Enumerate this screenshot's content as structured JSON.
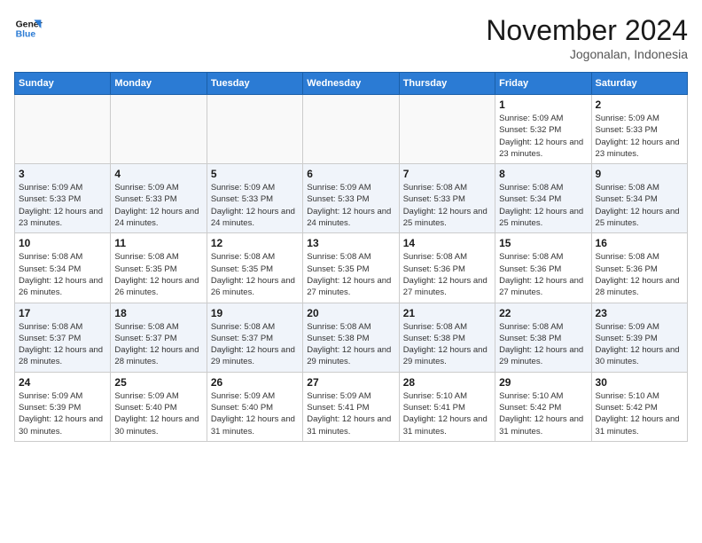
{
  "logo": {
    "line1": "General",
    "line2": "Blue"
  },
  "title": "November 2024",
  "location": "Jogonalan, Indonesia",
  "weekdays": [
    "Sunday",
    "Monday",
    "Tuesday",
    "Wednesday",
    "Thursday",
    "Friday",
    "Saturday"
  ],
  "weeks": [
    [
      {
        "day": "",
        "info": ""
      },
      {
        "day": "",
        "info": ""
      },
      {
        "day": "",
        "info": ""
      },
      {
        "day": "",
        "info": ""
      },
      {
        "day": "",
        "info": ""
      },
      {
        "day": "1",
        "info": "Sunrise: 5:09 AM\nSunset: 5:32 PM\nDaylight: 12 hours and 23 minutes."
      },
      {
        "day": "2",
        "info": "Sunrise: 5:09 AM\nSunset: 5:33 PM\nDaylight: 12 hours and 23 minutes."
      }
    ],
    [
      {
        "day": "3",
        "info": "Sunrise: 5:09 AM\nSunset: 5:33 PM\nDaylight: 12 hours and 23 minutes."
      },
      {
        "day": "4",
        "info": "Sunrise: 5:09 AM\nSunset: 5:33 PM\nDaylight: 12 hours and 24 minutes."
      },
      {
        "day": "5",
        "info": "Sunrise: 5:09 AM\nSunset: 5:33 PM\nDaylight: 12 hours and 24 minutes."
      },
      {
        "day": "6",
        "info": "Sunrise: 5:09 AM\nSunset: 5:33 PM\nDaylight: 12 hours and 24 minutes."
      },
      {
        "day": "7",
        "info": "Sunrise: 5:08 AM\nSunset: 5:33 PM\nDaylight: 12 hours and 25 minutes."
      },
      {
        "day": "8",
        "info": "Sunrise: 5:08 AM\nSunset: 5:34 PM\nDaylight: 12 hours and 25 minutes."
      },
      {
        "day": "9",
        "info": "Sunrise: 5:08 AM\nSunset: 5:34 PM\nDaylight: 12 hours and 25 minutes."
      }
    ],
    [
      {
        "day": "10",
        "info": "Sunrise: 5:08 AM\nSunset: 5:34 PM\nDaylight: 12 hours and 26 minutes."
      },
      {
        "day": "11",
        "info": "Sunrise: 5:08 AM\nSunset: 5:35 PM\nDaylight: 12 hours and 26 minutes."
      },
      {
        "day": "12",
        "info": "Sunrise: 5:08 AM\nSunset: 5:35 PM\nDaylight: 12 hours and 26 minutes."
      },
      {
        "day": "13",
        "info": "Sunrise: 5:08 AM\nSunset: 5:35 PM\nDaylight: 12 hours and 27 minutes."
      },
      {
        "day": "14",
        "info": "Sunrise: 5:08 AM\nSunset: 5:36 PM\nDaylight: 12 hours and 27 minutes."
      },
      {
        "day": "15",
        "info": "Sunrise: 5:08 AM\nSunset: 5:36 PM\nDaylight: 12 hours and 27 minutes."
      },
      {
        "day": "16",
        "info": "Sunrise: 5:08 AM\nSunset: 5:36 PM\nDaylight: 12 hours and 28 minutes."
      }
    ],
    [
      {
        "day": "17",
        "info": "Sunrise: 5:08 AM\nSunset: 5:37 PM\nDaylight: 12 hours and 28 minutes."
      },
      {
        "day": "18",
        "info": "Sunrise: 5:08 AM\nSunset: 5:37 PM\nDaylight: 12 hours and 28 minutes."
      },
      {
        "day": "19",
        "info": "Sunrise: 5:08 AM\nSunset: 5:37 PM\nDaylight: 12 hours and 29 minutes."
      },
      {
        "day": "20",
        "info": "Sunrise: 5:08 AM\nSunset: 5:38 PM\nDaylight: 12 hours and 29 minutes."
      },
      {
        "day": "21",
        "info": "Sunrise: 5:08 AM\nSunset: 5:38 PM\nDaylight: 12 hours and 29 minutes."
      },
      {
        "day": "22",
        "info": "Sunrise: 5:08 AM\nSunset: 5:38 PM\nDaylight: 12 hours and 29 minutes."
      },
      {
        "day": "23",
        "info": "Sunrise: 5:09 AM\nSunset: 5:39 PM\nDaylight: 12 hours and 30 minutes."
      }
    ],
    [
      {
        "day": "24",
        "info": "Sunrise: 5:09 AM\nSunset: 5:39 PM\nDaylight: 12 hours and 30 minutes."
      },
      {
        "day": "25",
        "info": "Sunrise: 5:09 AM\nSunset: 5:40 PM\nDaylight: 12 hours and 30 minutes."
      },
      {
        "day": "26",
        "info": "Sunrise: 5:09 AM\nSunset: 5:40 PM\nDaylight: 12 hours and 31 minutes."
      },
      {
        "day": "27",
        "info": "Sunrise: 5:09 AM\nSunset: 5:41 PM\nDaylight: 12 hours and 31 minutes."
      },
      {
        "day": "28",
        "info": "Sunrise: 5:10 AM\nSunset: 5:41 PM\nDaylight: 12 hours and 31 minutes."
      },
      {
        "day": "29",
        "info": "Sunrise: 5:10 AM\nSunset: 5:42 PM\nDaylight: 12 hours and 31 minutes."
      },
      {
        "day": "30",
        "info": "Sunrise: 5:10 AM\nSunset: 5:42 PM\nDaylight: 12 hours and 31 minutes."
      }
    ]
  ]
}
